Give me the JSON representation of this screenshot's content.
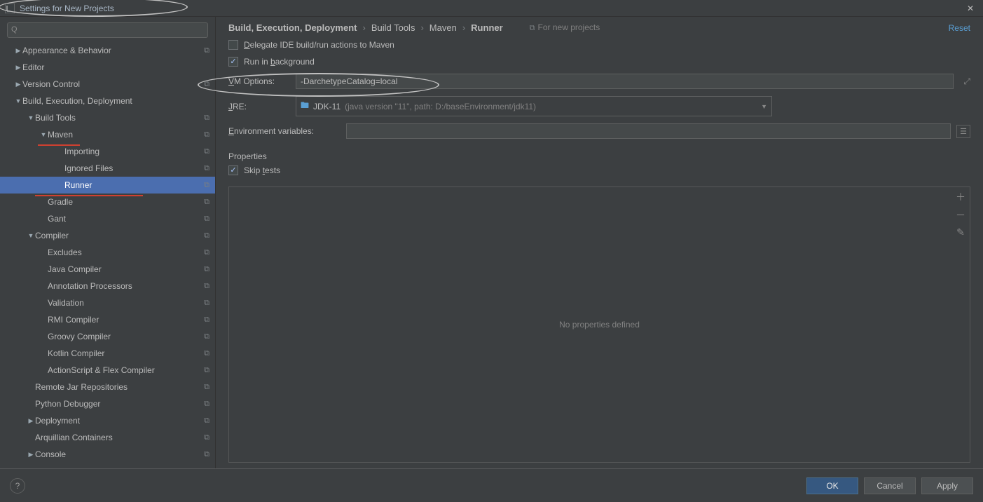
{
  "window": {
    "title": "Settings for New Projects"
  },
  "search": {
    "placeholder": ""
  },
  "sidebar": {
    "items": [
      {
        "label": "Appearance & Behavior",
        "depth": 0,
        "arrow": "▶",
        "copy": true
      },
      {
        "label": "Editor",
        "depth": 0,
        "arrow": "▶"
      },
      {
        "label": "Version Control",
        "depth": 0,
        "arrow": "▶",
        "copy": true
      },
      {
        "label": "Build, Execution, Deployment",
        "depth": 0,
        "arrow": "▼"
      },
      {
        "label": "Build Tools",
        "depth": 1,
        "arrow": "▼",
        "copy": true
      },
      {
        "label": "Maven",
        "depth": 2,
        "arrow": "▼",
        "copy": true
      },
      {
        "label": "Importing",
        "depth": 3,
        "arrow": "",
        "copy": true
      },
      {
        "label": "Ignored Files",
        "depth": 3,
        "arrow": "",
        "copy": true
      },
      {
        "label": "Runner",
        "depth": 3,
        "arrow": "",
        "copy": true,
        "selected": true
      },
      {
        "label": "Gradle",
        "depth": 2,
        "arrow": "",
        "copy": true
      },
      {
        "label": "Gant",
        "depth": 2,
        "arrow": "",
        "copy": true
      },
      {
        "label": "Compiler",
        "depth": 1,
        "arrow": "▼",
        "copy": true
      },
      {
        "label": "Excludes",
        "depth": 2,
        "arrow": "",
        "copy": true
      },
      {
        "label": "Java Compiler",
        "depth": 2,
        "arrow": "",
        "copy": true
      },
      {
        "label": "Annotation Processors",
        "depth": 2,
        "arrow": "",
        "copy": true
      },
      {
        "label": "Validation",
        "depth": 2,
        "arrow": "",
        "copy": true
      },
      {
        "label": "RMI Compiler",
        "depth": 2,
        "arrow": "",
        "copy": true
      },
      {
        "label": "Groovy Compiler",
        "depth": 2,
        "arrow": "",
        "copy": true
      },
      {
        "label": "Kotlin Compiler",
        "depth": 2,
        "arrow": "",
        "copy": true
      },
      {
        "label": "ActionScript & Flex Compiler",
        "depth": 2,
        "arrow": "",
        "copy": true
      },
      {
        "label": "Remote Jar Repositories",
        "depth": 1,
        "arrow": "",
        "copy": true
      },
      {
        "label": "Python Debugger",
        "depth": 1,
        "arrow": "",
        "copy": true
      },
      {
        "label": "Deployment",
        "depth": 1,
        "arrow": "▶",
        "copy": true
      },
      {
        "label": "Arquillian Containers",
        "depth": 1,
        "arrow": "",
        "copy": true
      },
      {
        "label": "Console",
        "depth": 1,
        "arrow": "▶",
        "copy": true
      }
    ]
  },
  "breadcrumb": {
    "p1": "Build, Execution, Deployment",
    "p2": "Build Tools",
    "p3": "Maven",
    "p4": "Runner",
    "new_proj": "For new projects",
    "reset": "Reset"
  },
  "form": {
    "delegate_label_pre": "D",
    "delegate_label_rest": "elegate IDE build/run actions to Maven",
    "run_bg_pre": "Run in ",
    "run_bg_u": "b",
    "run_bg_post": "ackground",
    "vm_label_u": "V",
    "vm_label_rest": "M Options:",
    "vm_value": "-DarchetypeCatalog=local",
    "jre_label_u": "J",
    "jre_label_rest": "RE:",
    "jre_name": "JDK-11",
    "jre_path": "(java version \"11\", path: D:/baseEnvironment/jdk11)",
    "env_label_u": "E",
    "env_label_rest": "nvironment variables:",
    "properties_section": "Properties",
    "skip_tests_pre": "Skip ",
    "skip_tests_u": "t",
    "skip_tests_post": "ests",
    "no_props": "No properties defined"
  },
  "footer": {
    "ok": "OK",
    "cancel": "Cancel",
    "apply": "Apply"
  }
}
